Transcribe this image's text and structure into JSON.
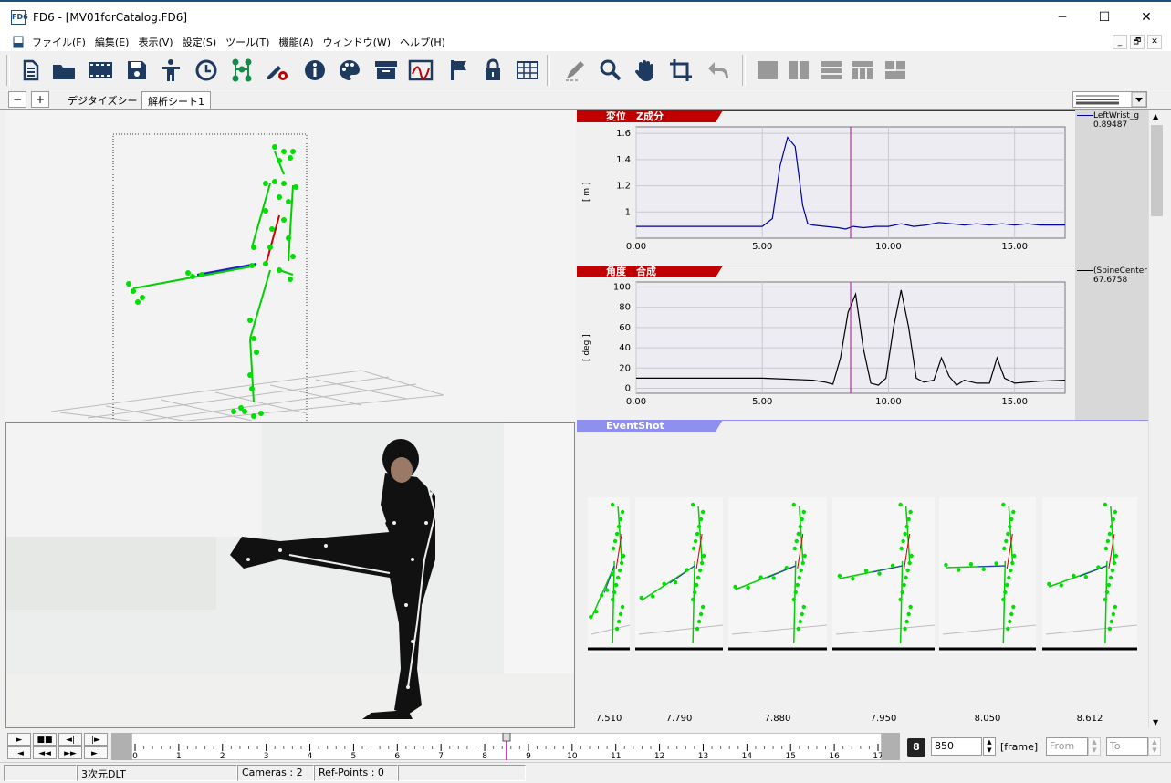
{
  "window": {
    "title": "FD6  - [MV01forCatalog.FD6]",
    "app_icon": "FD6",
    "minimize": "─",
    "maximize": "☐",
    "close": "✕"
  },
  "menu": {
    "items": [
      "ファイル(F)",
      "編集(E)",
      "表示(V)",
      "設定(S)",
      "ツール(T)",
      "機能(A)",
      "ウィンドウ(W)",
      "ヘルプ(H)"
    ],
    "mdi_min": "_",
    "mdi_restore": "🗗",
    "mdi_close": "✕"
  },
  "toolbar": {
    "icons": [
      "document-icon",
      "folder-icon",
      "film-icon",
      "save-icon",
      "person-icon",
      "clock-icon",
      "skeleton-icon",
      "pen-gear-icon",
      "info-icon",
      "palette-icon",
      "archive-icon",
      "graph-icon",
      "flag-icon",
      "lock-icon",
      "grid-icon",
      "pencil-icon",
      "zoom-icon",
      "hand-icon",
      "crop-icon",
      "undo-icon",
      "layout-single-icon",
      "layout-vsplit-icon",
      "layout-hsplit-icon",
      "layout-3pane-icon",
      "layout-4pane-icon"
    ]
  },
  "tabs": {
    "minus": "−",
    "plus": "+",
    "items": [
      "デジタイズシート",
      "解析シート1"
    ],
    "active": 1
  },
  "graph1": {
    "title": "変位　Z成分",
    "ylabel": "[ m ]",
    "legend": "LeftWrist_g",
    "legend_value": "0.89487"
  },
  "graph2": {
    "title": "角度　合成",
    "ylabel": "[ deg ]",
    "legend": "(SpineCenter",
    "legend_value": "67.6758"
  },
  "events": {
    "title": "EventShot",
    "times": [
      "7.510",
      "7.790",
      "7.880",
      "7.950",
      "8.050",
      "8.612"
    ]
  },
  "chart_data": [
    {
      "type": "line",
      "title": "変位　Z成分",
      "ylabel": "[ m ]",
      "xlim": [
        0,
        17
      ],
      "ylim": [
        0.8,
        1.65
      ],
      "xticks": [
        "0.00",
        "5.00",
        "10.00",
        "15.00"
      ],
      "yticks": [
        "1",
        "1.2",
        "1.4",
        "1.6"
      ],
      "series": [
        {
          "name": "LeftWrist_g",
          "color": "#0000a0",
          "x": [
            0,
            5.0,
            5.4,
            5.7,
            6.0,
            6.3,
            6.6,
            6.8,
            7.0,
            7.5,
            8.0,
            8.3,
            8.6,
            9.0,
            9.5,
            10.0,
            10.5,
            11.0,
            11.5,
            12.0,
            12.5,
            13.0,
            13.5,
            14.0,
            14.5,
            15.0,
            15.5,
            16.0,
            17.0
          ],
          "y": [
            0.89,
            0.89,
            0.95,
            1.35,
            1.57,
            1.5,
            1.05,
            0.91,
            0.9,
            0.89,
            0.88,
            0.87,
            0.89,
            0.88,
            0.89,
            0.89,
            0.91,
            0.89,
            0.9,
            0.92,
            0.91,
            0.9,
            0.91,
            0.9,
            0.91,
            0.9,
            0.91,
            0.9,
            0.9
          ]
        }
      ],
      "cursor_x": 8.5
    },
    {
      "type": "line",
      "title": "角度　合成",
      "ylabel": "[ deg ]",
      "xlim": [
        0,
        17
      ],
      "ylim": [
        -5,
        105
      ],
      "xticks": [
        "0.00",
        "5.00",
        "10.00",
        "15.00"
      ],
      "yticks": [
        "0",
        "20",
        "40",
        "60",
        "80",
        "100"
      ],
      "series": [
        {
          "name": "(SpineCenter",
          "color": "#000000",
          "x": [
            0,
            5.0,
            6.0,
            7.0,
            7.5,
            7.8,
            8.1,
            8.4,
            8.7,
            9.0,
            9.3,
            9.6,
            9.9,
            10.2,
            10.5,
            10.8,
            11.1,
            11.4,
            11.8,
            12.1,
            12.4,
            12.7,
            13.0,
            13.5,
            14.0,
            14.3,
            14.6,
            15.0,
            15.5,
            16.0,
            17.0
          ],
          "y": [
            10,
            10,
            9,
            8,
            6,
            4,
            30,
            75,
            93,
            40,
            5,
            3,
            10,
            60,
            97,
            60,
            10,
            6,
            8,
            30,
            12,
            3,
            8,
            5,
            5,
            30,
            10,
            5,
            6,
            7,
            8
          ]
        }
      ],
      "cursor_x": 8.5
    }
  ],
  "timeline": {
    "ticks": [
      "0",
      "1",
      "2",
      "3",
      "4",
      "5",
      "6",
      "7",
      "8",
      "9",
      "10",
      "11",
      "12",
      "13",
      "14",
      "15",
      "16",
      "17"
    ],
    "frame": "850",
    "unit": "[frame]",
    "from": "From",
    "to": "To"
  },
  "status": {
    "mode": "3次元DLT",
    "cameras": "Cameras : 2",
    "refpoints": "Ref-Points : 0"
  }
}
